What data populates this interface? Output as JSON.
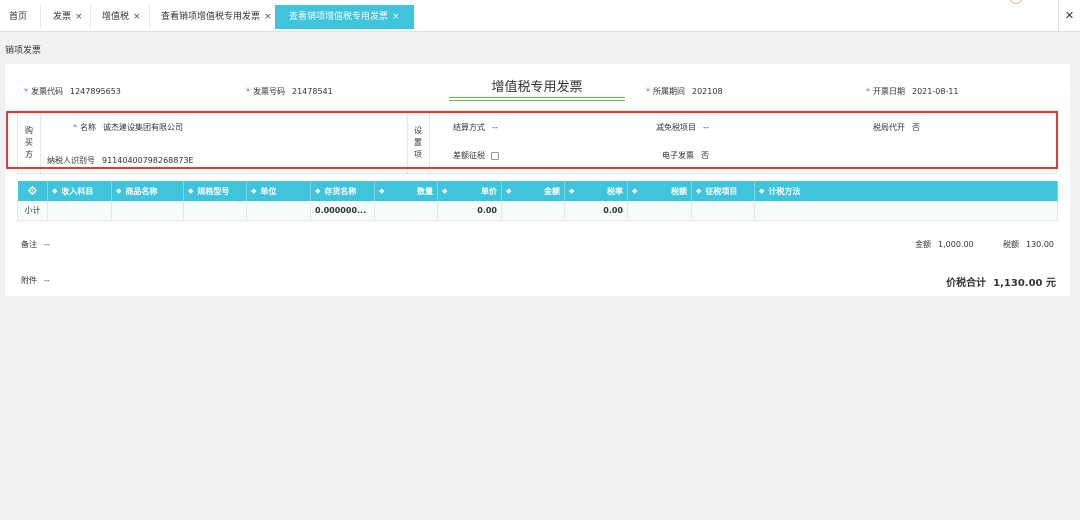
{
  "tabs": [
    {
      "label": "首页",
      "closable": false
    },
    {
      "label": "发票",
      "closable": true
    },
    {
      "label": "增值税",
      "closable": true
    },
    {
      "label": "查看销项增值税专用发票",
      "closable": true
    },
    {
      "label": "查看销项增值税专用发票",
      "closable": true,
      "active": true
    }
  ],
  "tab_close_glyph": "×",
  "window_close_glyph": "✕",
  "page_title": "销项发票",
  "invoice": {
    "title": "增值税专用发票",
    "code_label": "发票代码",
    "code_value": "1247895653",
    "number_label": "发票号码",
    "number_value": "21478541",
    "period_label": "所属期间",
    "period_value": "202108",
    "date_label": "开票日期",
    "date_value": "2021-08-11"
  },
  "buyer": {
    "section_label": [
      "购",
      "买",
      "方"
    ],
    "name_label": "名称",
    "name_value": "诚杰建设集团有限公司",
    "tax_id_label": "纳税人识别号",
    "tax_id_value": "91140400798268873E"
  },
  "settings": {
    "section_label": [
      "设",
      "置",
      "项"
    ],
    "settlement_label": "结算方式",
    "settlement_value": "--",
    "exempt_label": "减免税项目",
    "exempt_value": "--",
    "agent_label": "税局代开",
    "agent_value": "否",
    "diff_tax_label": "差额征税",
    "diff_tax_checked": false,
    "e_invoice_label": "电子发票",
    "e_invoice_value": "否"
  },
  "table": {
    "headers": [
      "收入科目",
      "商品名称",
      "规格型号",
      "单位",
      "存货名称",
      "数量",
      "单价",
      "金额",
      "税率",
      "税额",
      "征税项目",
      "计税方法"
    ],
    "subtotal": {
      "label": "小计",
      "quantity": "0.000000...",
      "amount": "0.00",
      "tax": "0.00"
    }
  },
  "footer": {
    "remark_label": "备注",
    "remark_value": "--",
    "attachment_label": "附件",
    "attachment_value": "--",
    "amount_label": "金额",
    "amount_value": "1,000.00",
    "tax_label": "税额",
    "tax_value": "130.00",
    "total_label": "价税合计",
    "total_value": "1,130.00 元"
  },
  "colors": {
    "accent": "#3fc4dc",
    "required": "#e14b4b",
    "highlight": "#e03a3a"
  },
  "icons": {
    "settings": "gear-icon",
    "sort": "sort-icon",
    "close": "close-icon"
  }
}
